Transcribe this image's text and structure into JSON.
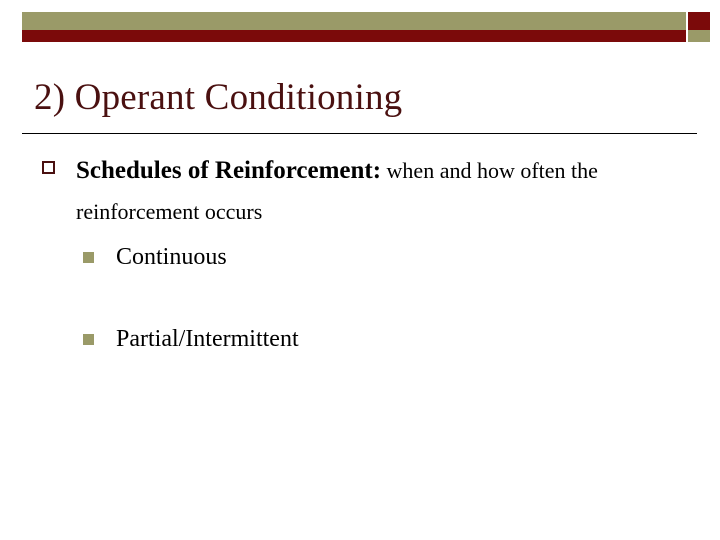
{
  "slide": {
    "title": "2)  Operant Conditioning",
    "header": {
      "olive_color": "#9a9a68",
      "red_color": "#7b0a0a"
    },
    "title_color": "#4a1010",
    "bullets": [
      {
        "level": 1,
        "marker": "hollow-square",
        "marker_color": "#4a1010",
        "bold_text": "Schedules of Reinforcement:",
        "normal_text": "when and how often the reinforcement occurs"
      },
      {
        "level": 2,
        "marker": "filled-square",
        "marker_color": "#9a9a68",
        "text": "Continuous"
      },
      {
        "level": 2,
        "marker": "filled-square",
        "marker_color": "#9a9a68",
        "text": "Partial/Intermittent"
      }
    ]
  }
}
